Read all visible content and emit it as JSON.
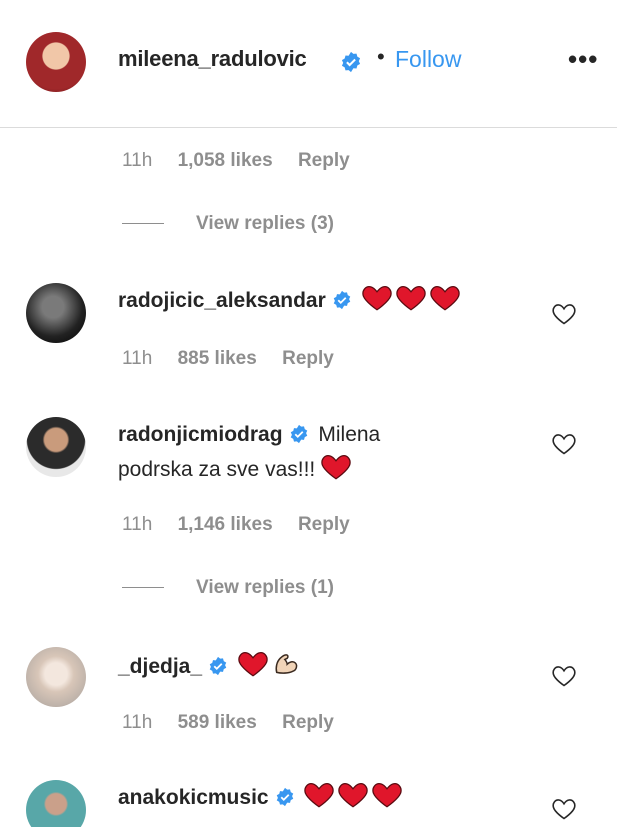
{
  "header": {
    "username": "mileena_radulovic",
    "separator": "•",
    "follow_label": "Follow",
    "more_label": "•••"
  },
  "first_meta": {
    "time": "11h",
    "likes": "1,058 likes",
    "reply": "Reply"
  },
  "first_view_replies": "View replies (3)",
  "comments": [
    {
      "username": "radojicic_aleksandar",
      "text": "",
      "emoji": "❤❤❤",
      "time": "11h",
      "likes": "885 likes",
      "reply": "Reply"
    },
    {
      "username": "radonjicmiodrag",
      "text_line1": "Milena",
      "text_line2": "podrska za sve vas!!!",
      "emoji": "❤",
      "time": "11h",
      "likes": "1,146 likes",
      "reply": "Reply",
      "view_replies": "View replies (1)"
    },
    {
      "username": "_djedja_",
      "emoji": "❤💪",
      "time": "11h",
      "likes": "589 likes",
      "reply": "Reply"
    },
    {
      "username": "anakokicmusic",
      "emoji": "❤❤❤"
    }
  ],
  "colors": {
    "accent": "#3897f0",
    "verified": "#3897f0",
    "heart": "#ed4956",
    "muted": "#8e8e8e",
    "text": "#262626"
  }
}
